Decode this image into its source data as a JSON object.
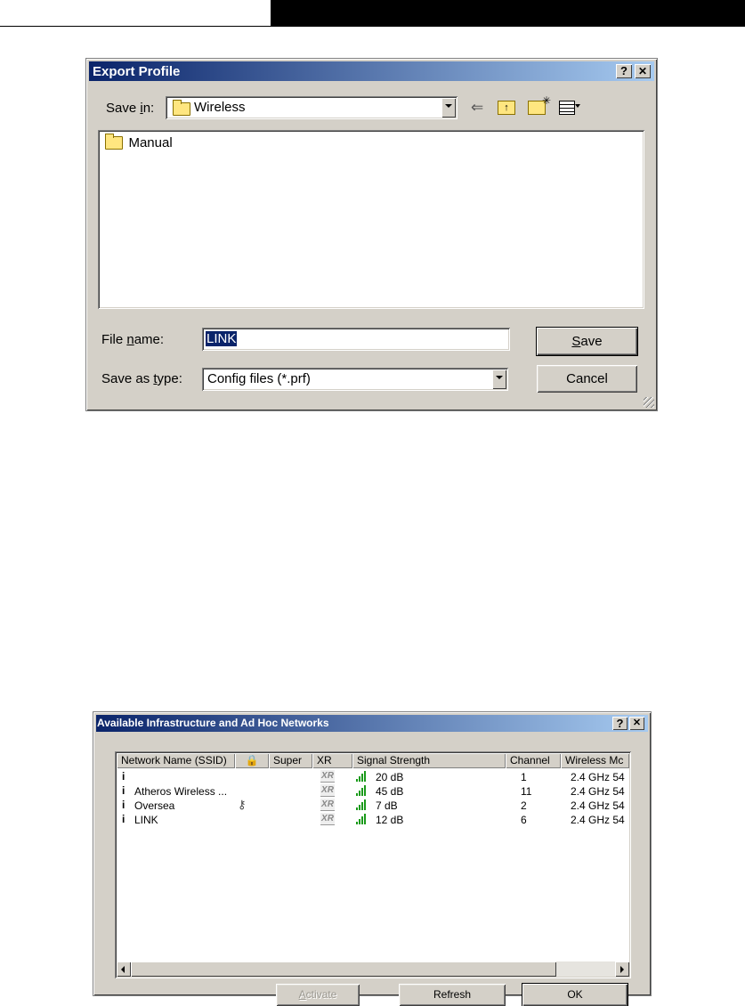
{
  "export_dialog": {
    "title": "Export Profile",
    "help_btn": "?",
    "close_btn": "✕",
    "save_in_label_pre": "Save ",
    "save_in_label_u": "i",
    "save_in_label_post": "n:",
    "save_in_value": "Wireless",
    "files": [
      "Manual"
    ],
    "file_name_label_pre": "File ",
    "file_name_label_u": "n",
    "file_name_label_post": "ame:",
    "file_name_value": "LINK",
    "save_type_label_pre": "Save as ",
    "save_type_label_u": "t",
    "save_type_label_post": "ype:",
    "save_type_value": "Config files (*.prf)",
    "save_btn_u": "S",
    "save_btn_rest": "ave",
    "cancel_btn": "Cancel"
  },
  "networks_dialog": {
    "title": "Available Infrastructure and Ad Hoc Networks",
    "help_btn": "?",
    "close_btn": "✕",
    "columns": [
      "Network Name (SSID)",
      "",
      "Super",
      "XR",
      "Signal Strength",
      "Channel",
      "Wireless Mc"
    ],
    "rows": [
      {
        "ssid": "",
        "secured": false,
        "xr": "XR",
        "signal": "20 dB",
        "channel": "1",
        "mode": "2.4 GHz 54"
      },
      {
        "ssid": "Atheros Wireless ...",
        "secured": false,
        "xr": "XR",
        "signal": "45 dB",
        "channel": "11",
        "mode": "2.4 GHz 54"
      },
      {
        "ssid": "Oversea",
        "secured": true,
        "xr": "XR",
        "signal": "7 dB",
        "channel": "2",
        "mode": "2.4 GHz 54"
      },
      {
        "ssid": "LINK",
        "secured": false,
        "xr": "XR",
        "signal": "12 dB",
        "channel": "6",
        "mode": "2.4 GHz 54"
      }
    ],
    "activate_btn_u": "A",
    "activate_btn_rest": "ctivate",
    "refresh_btn": "Refresh",
    "ok_btn": "OK"
  },
  "colors": {
    "titlebar_start": "#0a246a",
    "titlebar_end": "#a6caf0",
    "dialog_face": "#d4d0c8",
    "signal_green": "#1a9a1a"
  }
}
